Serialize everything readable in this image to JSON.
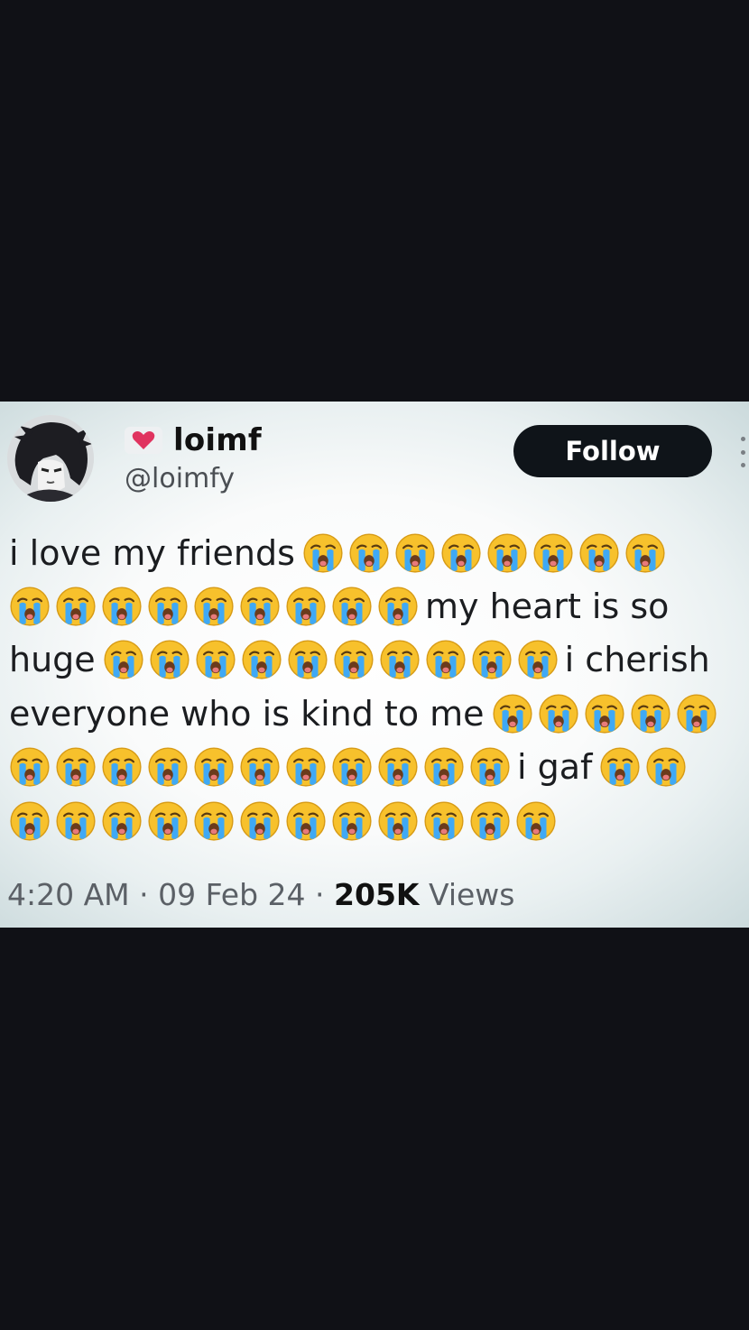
{
  "tweet": {
    "author": {
      "display_name": "loimf",
      "handle": "@loimfy",
      "name_badge_icon": "heart-emoji",
      "avatar_icon": "anime-avatar-icon"
    },
    "follow_label": "Follow",
    "body_lines": [
      {
        "text_before": "i love my friends",
        "emoji_count": 8,
        "text_after": ""
      },
      {
        "text_before": "",
        "emoji_count": 9,
        "text_after": "my heart is so"
      },
      {
        "text_before": "huge",
        "emoji_count": 10,
        "text_after": "i cherish"
      },
      {
        "text_before": "everyone who is kind to me",
        "emoji_count": 5,
        "text_after": ""
      },
      {
        "text_before": "",
        "emoji_count": 11,
        "text_after": "i gaf"
      },
      {
        "text_before": "",
        "emoji_count": 12,
        "text_after": ""
      }
    ],
    "extra_emoji_after_gaf": 2,
    "emoji_icon": "loudly-crying-face-emoji",
    "meta": {
      "time": "4:20 AM",
      "date": "09 Feb 24",
      "views_count": "205K",
      "views_label": "Views"
    }
  },
  "colors": {
    "page_background": "#101116",
    "button_background": "#0f1419",
    "emoji_face": "#f7c12c",
    "emoji_tears": "#3fa9f5"
  }
}
